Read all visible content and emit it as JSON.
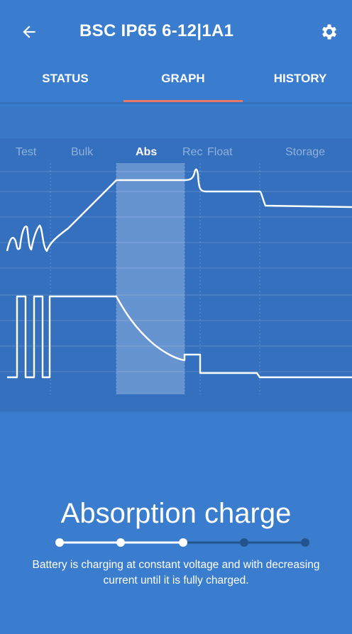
{
  "header": {
    "title": "BSC IP65 6-12|1A1",
    "back_icon": "back-arrow-icon",
    "settings_icon": "gear-icon"
  },
  "tabs": [
    {
      "label": "STATUS",
      "active": false
    },
    {
      "label": "GRAPH",
      "active": true
    },
    {
      "label": "HISTORY",
      "active": false
    }
  ],
  "graph": {
    "stages": [
      "Test",
      "Bulk",
      "Abs",
      "Rec",
      "Float",
      "Storage"
    ],
    "active_stage": "Abs"
  },
  "status": {
    "title": "Absorption charge",
    "description": "Battery is charging at constant voltage and with decreasing current until it is fully charged.",
    "progress_step": 3,
    "progress_total": 5
  },
  "colors": {
    "background": "#3a7ccd",
    "tab_indicator": "#e8786a",
    "highlight": "#8fb3e0"
  }
}
